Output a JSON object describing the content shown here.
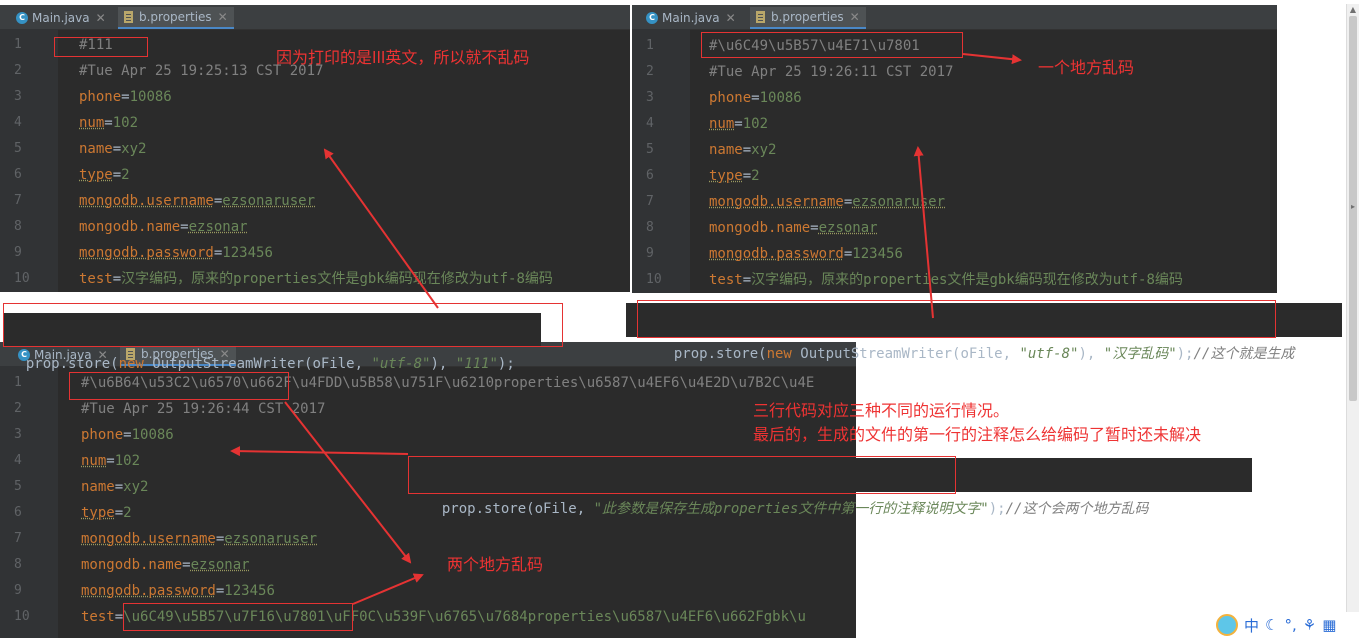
{
  "tabs": {
    "main": "Main.java",
    "props": "b.properties"
  },
  "editor1": {
    "lines": [
      {
        "n": "1",
        "segs": [
          [
            "com",
            "#111"
          ]
        ]
      },
      {
        "n": "2",
        "segs": [
          [
            "com",
            "#Tue Apr 25 19:25:13 CST 2017"
          ]
        ]
      },
      {
        "n": "3",
        "segs": [
          [
            "key",
            "phone"
          ],
          [
            "txt",
            "="
          ],
          [
            "val",
            "10086"
          ]
        ]
      },
      {
        "n": "4",
        "segs": [
          [
            "keyu",
            "num"
          ],
          [
            "txt",
            "="
          ],
          [
            "val",
            "102"
          ]
        ]
      },
      {
        "n": "5",
        "segs": [
          [
            "key",
            "name"
          ],
          [
            "txt",
            "="
          ],
          [
            "val",
            "xy2"
          ]
        ]
      },
      {
        "n": "6",
        "segs": [
          [
            "keyu",
            "type"
          ],
          [
            "txt",
            "="
          ],
          [
            "val",
            "2"
          ]
        ]
      },
      {
        "n": "7",
        "segs": [
          [
            "keyu",
            "mongodb.username"
          ],
          [
            "txt",
            "="
          ],
          [
            "valu",
            "ezsonaruser"
          ]
        ]
      },
      {
        "n": "8",
        "segs": [
          [
            "key",
            "mongodb.name"
          ],
          [
            "txt",
            "="
          ],
          [
            "valu",
            "ezsonar"
          ]
        ]
      },
      {
        "n": "9",
        "segs": [
          [
            "keyu",
            "mongodb.password"
          ],
          [
            "txt",
            "="
          ],
          [
            "val",
            "123456"
          ]
        ]
      },
      {
        "n": "10",
        "segs": [
          [
            "key",
            "test"
          ],
          [
            "txt",
            "="
          ],
          [
            "val",
            "汉字编码，原来的properties文件是gbk编码现在修改为utf-8编码"
          ]
        ]
      }
    ]
  },
  "editor2": {
    "lines": [
      {
        "n": "1",
        "segs": [
          [
            "com",
            "#\\u6C49\\u5B57\\u4E71\\u7801"
          ]
        ]
      },
      {
        "n": "2",
        "segs": [
          [
            "com",
            "#Tue Apr 25 19:26:11 CST 2017"
          ]
        ]
      },
      {
        "n": "3",
        "segs": [
          [
            "key",
            "phone"
          ],
          [
            "txt",
            "="
          ],
          [
            "val",
            "10086"
          ]
        ]
      },
      {
        "n": "4",
        "segs": [
          [
            "keyu",
            "num"
          ],
          [
            "txt",
            "="
          ],
          [
            "val",
            "102"
          ]
        ]
      },
      {
        "n": "5",
        "segs": [
          [
            "key",
            "name"
          ],
          [
            "txt",
            "="
          ],
          [
            "val",
            "xy2"
          ]
        ]
      },
      {
        "n": "6",
        "segs": [
          [
            "keyu",
            "type"
          ],
          [
            "txt",
            "="
          ],
          [
            "val",
            "2"
          ]
        ]
      },
      {
        "n": "7",
        "segs": [
          [
            "keyu",
            "mongodb.username"
          ],
          [
            "txt",
            "="
          ],
          [
            "valu",
            "ezsonaruser"
          ]
        ]
      },
      {
        "n": "8",
        "segs": [
          [
            "key",
            "mongodb.name"
          ],
          [
            "txt",
            "="
          ],
          [
            "valu",
            "ezsonar"
          ]
        ]
      },
      {
        "n": "9",
        "segs": [
          [
            "keyu",
            "mongodb.password"
          ],
          [
            "txt",
            "="
          ],
          [
            "val",
            "123456"
          ]
        ]
      },
      {
        "n": "10",
        "segs": [
          [
            "key",
            "test"
          ],
          [
            "txt",
            "="
          ],
          [
            "val",
            "汉字编码，原来的properties文件是gbk编码现在修改为utf-8编码"
          ]
        ]
      }
    ]
  },
  "editor3": {
    "lines": [
      {
        "n": "1",
        "segs": [
          [
            "com",
            "#\\u6B64\\u53C2\\u6570\\u662F\\u4FDD\\u5B58\\u751F\\u6210properties\\u6587\\u4EF6\\u4E2D\\u7B2C\\u4E"
          ]
        ]
      },
      {
        "n": "2",
        "segs": [
          [
            "com",
            "#Tue Apr 25 19:26:44 CST 2017"
          ]
        ]
      },
      {
        "n": "3",
        "segs": [
          [
            "key",
            "phone"
          ],
          [
            "txt",
            "="
          ],
          [
            "val",
            "10086"
          ]
        ]
      },
      {
        "n": "4",
        "segs": [
          [
            "keyu",
            "num"
          ],
          [
            "txt",
            "="
          ],
          [
            "val",
            "102"
          ]
        ]
      },
      {
        "n": "5",
        "segs": [
          [
            "key",
            "name"
          ],
          [
            "txt",
            "="
          ],
          [
            "val",
            "xy2"
          ]
        ]
      },
      {
        "n": "6",
        "segs": [
          [
            "keyu",
            "type"
          ],
          [
            "txt",
            "="
          ],
          [
            "val",
            "2"
          ]
        ]
      },
      {
        "n": "7",
        "segs": [
          [
            "keyu",
            "mongodb.username"
          ],
          [
            "txt",
            "="
          ],
          [
            "valu",
            "ezsonaruser"
          ]
        ]
      },
      {
        "n": "8",
        "segs": [
          [
            "key",
            "mongodb.name"
          ],
          [
            "txt",
            "="
          ],
          [
            "valu",
            "ezsonar"
          ]
        ]
      },
      {
        "n": "9",
        "segs": [
          [
            "keyu",
            "mongodb.password"
          ],
          [
            "txt",
            "="
          ],
          [
            "val",
            "123456"
          ]
        ]
      },
      {
        "n": "10",
        "segs": [
          [
            "key",
            "test"
          ],
          [
            "txt",
            "="
          ],
          [
            "val",
            "\\u6C49\\u5B57\\u7F16\\u7801\\uFF0C\\u539F\\u6765\\u7684properties\\u6587\\u4EF6\\u662Fgbk\\u"
          ]
        ]
      }
    ]
  },
  "snippets": {
    "s1": {
      "a": "prop.store(",
      "kw": "new",
      "b": " OutputStreamWriter(oFile, ",
      "s1": "\"utf-8\"",
      "c": "), ",
      "s2": "\"111\"",
      "d": ");"
    },
    "s2": {
      "a": "prop.store(",
      "kw": "new",
      "b": " OutputStreamWriter(oFile, ",
      "s1": "\"utf-8\"",
      "c": "), ",
      "s2": "\"汉字乱码\"",
      "d": ");",
      "cm": "//这个就是生成"
    },
    "s3": {
      "a": "prop.store(oFile, ",
      "s1": "\"此参数是保存生成properties文件中第一行的注释说明文字\"",
      "d": ");",
      "cm": "//这个会两个地方乱码"
    }
  },
  "notes": {
    "n1": "因为打印的是lll英文，所以就不乱码",
    "n2": "一个地方乱码",
    "n3a": "三行代码对应三种不同的运行情况。",
    "n3b": "最后的，生成的文件的第一行的注释怎么给编码了暂时还未解决",
    "n4": "两个地方乱码"
  },
  "tray": {
    "ime": "中"
  },
  "colors": {
    "annotation": "#e53333",
    "editor_bg": "#2b2b2b",
    "keyword": "#cc7832",
    "string": "#6a8759",
    "comment": "#808080"
  }
}
